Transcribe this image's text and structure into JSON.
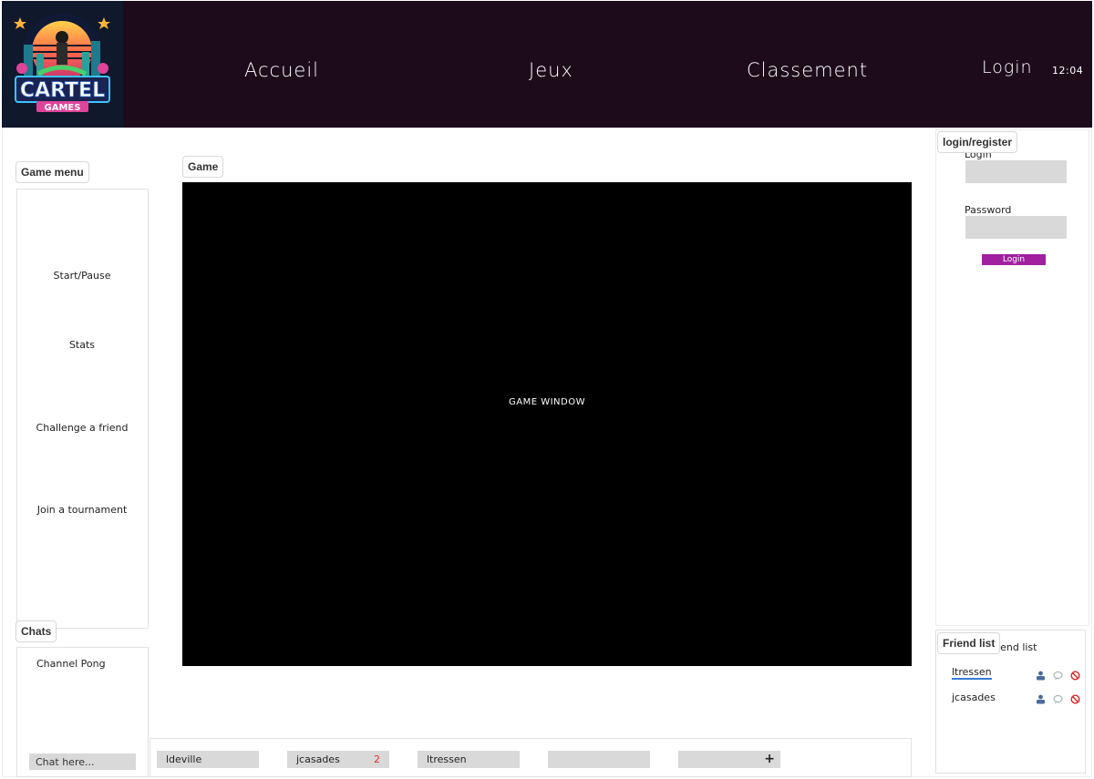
{
  "header": {
    "logo": {
      "line1": "CARTEL",
      "line2": "GAMES"
    },
    "nav": {
      "home": "Accueil",
      "games": "Jeux",
      "ranking": "Classement"
    },
    "login": "Login",
    "clock": "12:04"
  },
  "game_menu": {
    "tag": "Game menu",
    "items": [
      "Start/Pause",
      "Stats",
      "Challenge a friend",
      "Join a tournament"
    ]
  },
  "game": {
    "tag": "Game",
    "window_label": "GAME WINDOW"
  },
  "auth": {
    "tag": "login/register",
    "login_label": "Login",
    "password_label": "Password",
    "button": "Login"
  },
  "chats": {
    "tag": "Chats",
    "channel": "Channel Pong",
    "input_placeholder": "Chat here..."
  },
  "chat_tabs": [
    {
      "name": "ldeville",
      "badge": ""
    },
    {
      "name": "jcasades",
      "badge": "2"
    },
    {
      "name": "ltressen",
      "badge": ""
    },
    {
      "name": "",
      "badge": ""
    },
    {
      "name": "",
      "badge": "",
      "action": "+"
    }
  ],
  "friends": {
    "tag": "Friend list",
    "title_behind": "Friend list",
    "list": [
      {
        "name": "ltressen"
      },
      {
        "name": "jcasades"
      }
    ],
    "icons": [
      "user-icon",
      "message-icon",
      "block-icon"
    ]
  }
}
